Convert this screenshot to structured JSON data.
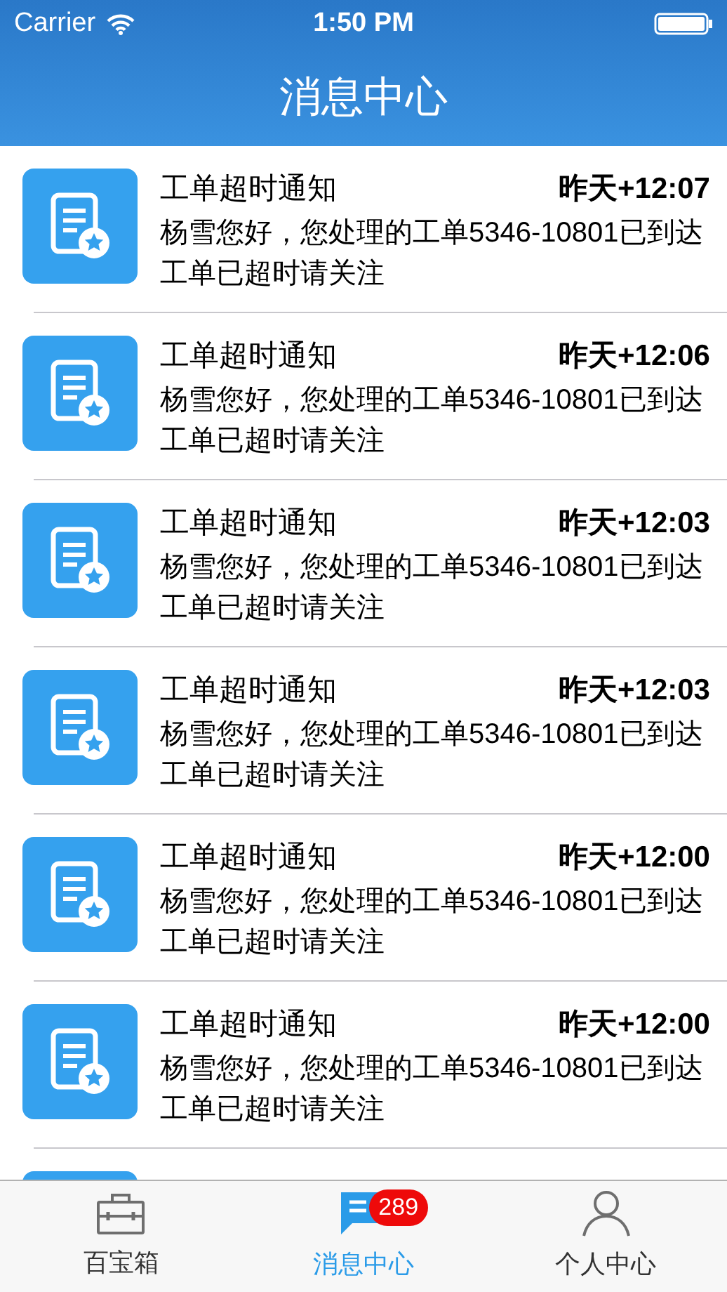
{
  "status_bar": {
    "carrier": "Carrier",
    "time": "1:50 PM"
  },
  "nav_bar": {
    "title": "消息中心"
  },
  "messages": [
    {
      "title": "工单超时通知",
      "time": "昨天+12:07",
      "body": "杨雪您好，您处理的工单5346-10801已到达工单已超时请关注"
    },
    {
      "title": "工单超时通知",
      "time": "昨天+12:06",
      "body": "杨雪您好，您处理的工单5346-10801已到达工单已超时请关注"
    },
    {
      "title": "工单超时通知",
      "time": "昨天+12:03",
      "body": "杨雪您好，您处理的工单5346-10801已到达工单已超时请关注"
    },
    {
      "title": "工单超时通知",
      "time": "昨天+12:03",
      "body": "杨雪您好，您处理的工单5346-10801已到达工单已超时请关注"
    },
    {
      "title": "工单超时通知",
      "time": "昨天+12:00",
      "body": "杨雪您好，您处理的工单5346-10801已到达工单已超时请关注"
    },
    {
      "title": "工单超时通知",
      "time": "昨天+12:00",
      "body": "杨雪您好，您处理的工单5346-10801已到达工单已超时请关注"
    }
  ],
  "tab_bar": [
    {
      "kind": "toolbox",
      "label": "百宝箱",
      "selected": false
    },
    {
      "kind": "messages",
      "label": "消息中心",
      "selected": true,
      "badge": "289"
    },
    {
      "kind": "person",
      "label": "个人中心",
      "selected": false
    }
  ]
}
